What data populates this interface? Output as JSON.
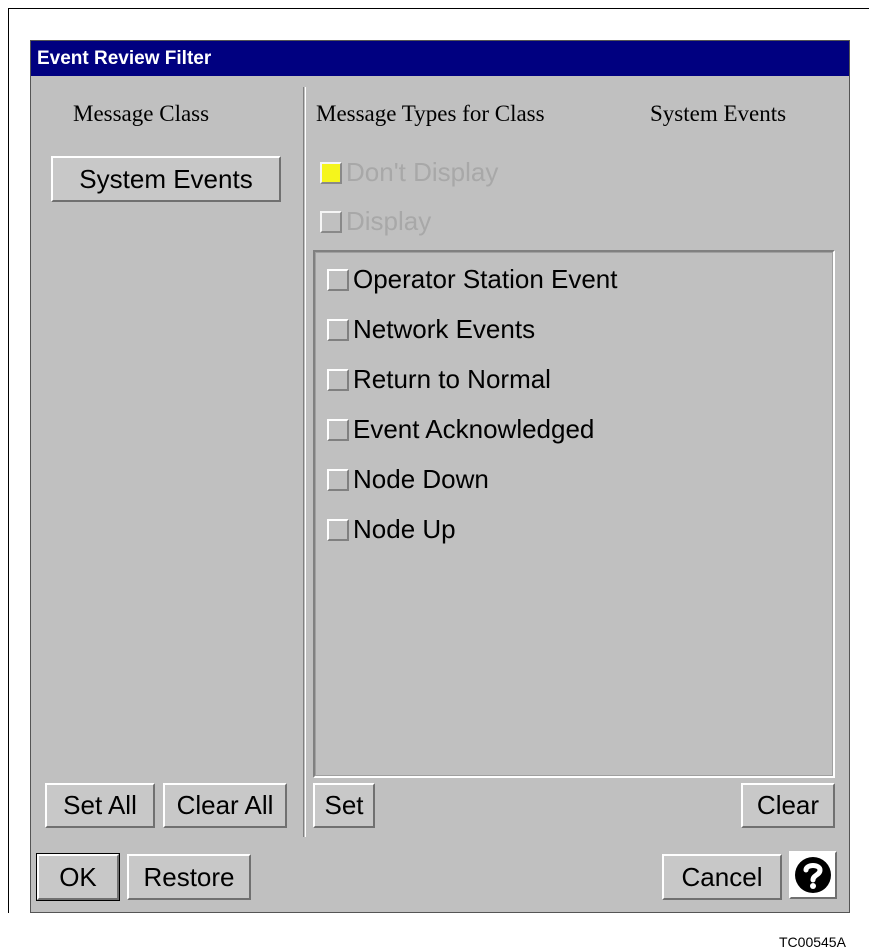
{
  "window": {
    "title": "Event Review Filter"
  },
  "left_panel": {
    "heading": "Message Class",
    "class_button": "System Events",
    "set_all": "Set All",
    "clear_all": "Clear All"
  },
  "right_panel": {
    "heading": "Message Types for Class",
    "current_class": "System Events",
    "dont_display": "Don't Display",
    "display": "Display",
    "message_types": [
      "Operator Station Event",
      "Network Events",
      "Return to Normal",
      "Event Acknowledged",
      "Node Down",
      "Node Up"
    ],
    "set": "Set",
    "clear": "Clear"
  },
  "footer": {
    "ok": "OK",
    "restore": "Restore",
    "cancel": "Cancel",
    "help_icon": "question-mark-circle-icon"
  },
  "figure_caption": "TC00545A",
  "colors": {
    "title_bar": "#000080",
    "panel_bg": "#c0c0c0",
    "dont_display_indicator": "#ffff00"
  }
}
